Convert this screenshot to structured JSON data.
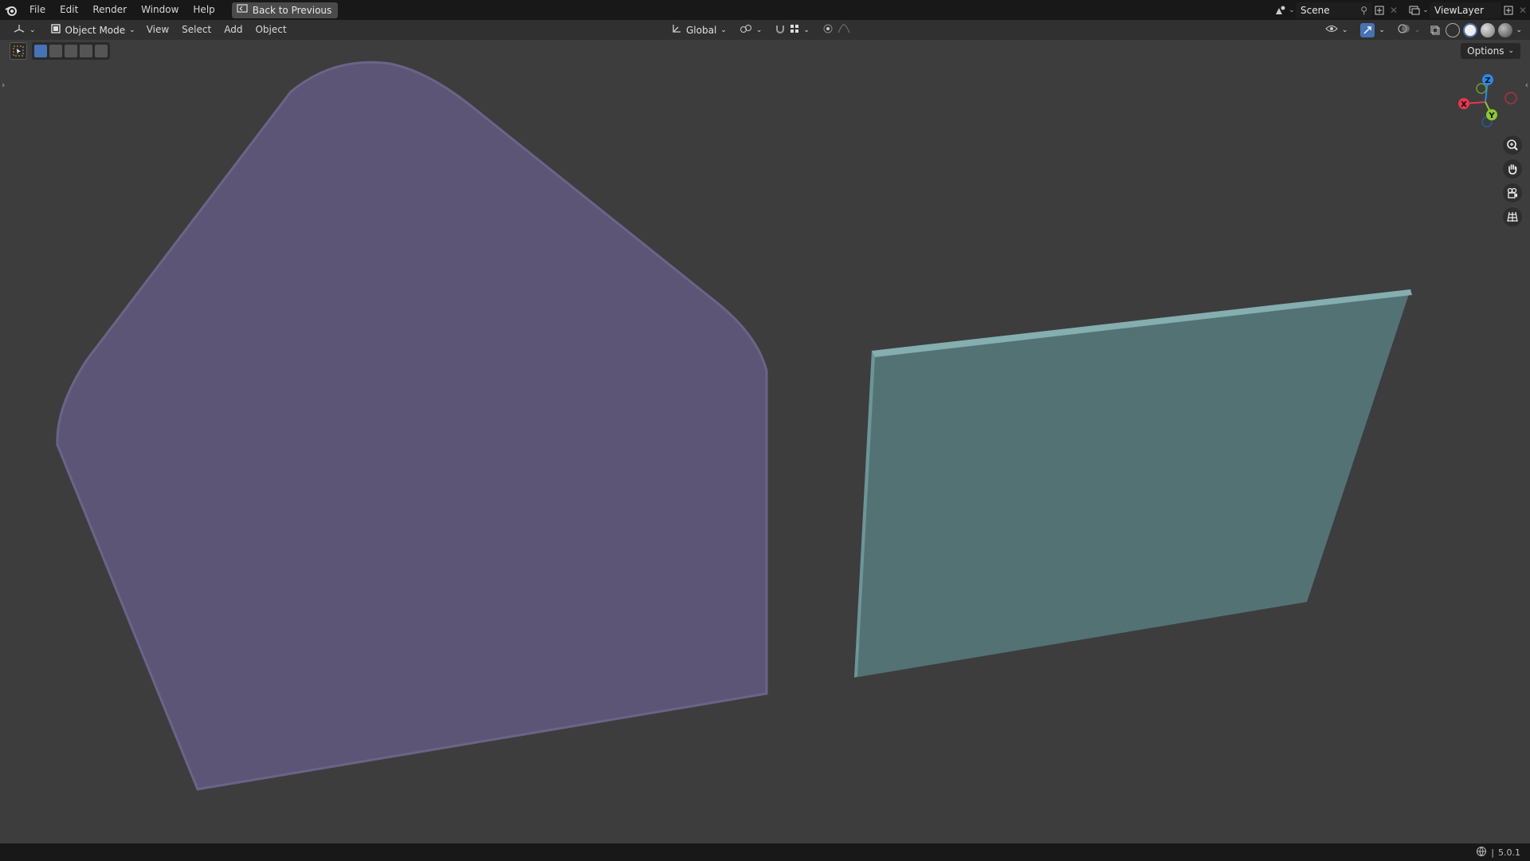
{
  "topbar": {
    "menus": [
      "File",
      "Edit",
      "Render",
      "Window",
      "Help"
    ],
    "back_label": "Back to Previous",
    "scene_label": "Scene",
    "viewlayer_label": "ViewLayer"
  },
  "header": {
    "mode_label": "Object Mode",
    "menus": [
      "View",
      "Select",
      "Add",
      "Object"
    ],
    "transform_orientation": "Global",
    "options_label": "Options"
  },
  "gizmo": {
    "x_label": "X",
    "y_label": "Y",
    "z_label": "Z",
    "colors": {
      "x": "#e5384e",
      "y": "#8bc831",
      "z": "#2d88e8"
    }
  },
  "status": {
    "version": "5.0.1"
  },
  "objects": {
    "left_color": "#5c5576",
    "right_color": "#537274"
  },
  "colors": {
    "background": "#3d3d3d",
    "topbar": "#181818",
    "header": "#303030",
    "accent": "#4772b3"
  }
}
